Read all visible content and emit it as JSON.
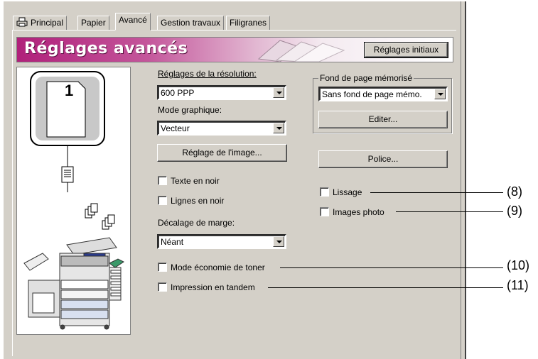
{
  "tabs": [
    {
      "label": "Principal",
      "active": false
    },
    {
      "label": "Papier",
      "active": false
    },
    {
      "label": "Avancé",
      "active": true
    },
    {
      "label": "Gestion travaux",
      "active": false
    },
    {
      "label": "Filigranes",
      "active": false
    }
  ],
  "banner": {
    "title": "Réglages avancés",
    "reset_button": "Réglages initiaux"
  },
  "preview": {
    "page_number": "1"
  },
  "resolution": {
    "label": "Réglages de la résolution:",
    "value": "600 PPP"
  },
  "graphics_mode": {
    "label": "Mode graphique:",
    "value": "Vecteur"
  },
  "image_adjust_button": "Réglage de l'image...",
  "checkboxes": {
    "text_black": "Texte en noir",
    "lines_black": "Lignes en noir",
    "smoothing": "Lissage",
    "photo": "Images photo",
    "toner_save": "Mode économie de toner",
    "tandem": "Impression en tandem"
  },
  "margin_shift": {
    "label": "Décalage de marge:",
    "value": "Néant"
  },
  "overlay": {
    "label": "Fond de page mémorisé",
    "value": "Sans fond de page mémo.",
    "edit_button": "Editer..."
  },
  "font_button": "Police...",
  "callouts": [
    "(8)",
    "(9)",
    "(10)",
    "(11)"
  ],
  "colors": {
    "dialog": "#d4d0c8",
    "banner": "#b0207a"
  }
}
